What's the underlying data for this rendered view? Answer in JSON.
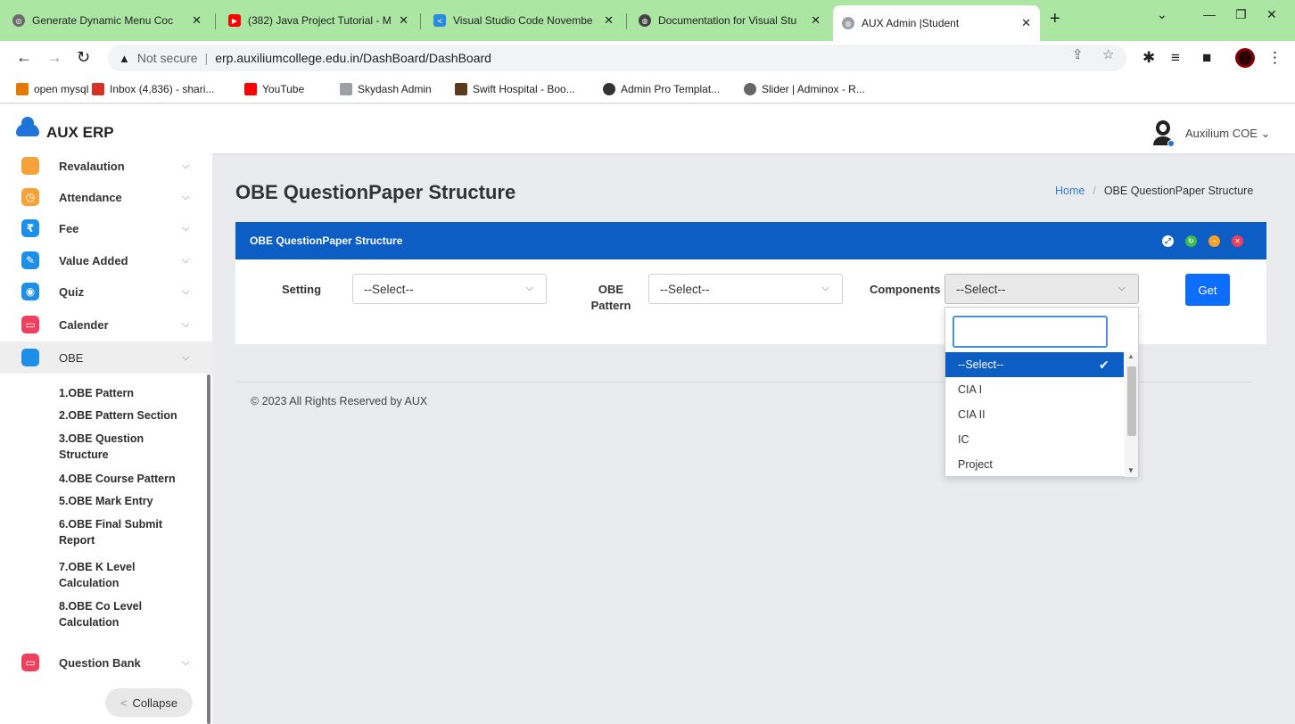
{
  "browser": {
    "tabs": [
      {
        "title": "Generate Dynamic Menu Coc",
        "favicon": "openai-icon",
        "color": "#6b6b6b"
      },
      {
        "title": "(382) Java Project Tutorial - M",
        "favicon": "youtube-icon",
        "color": "#ff0000"
      },
      {
        "title": "Visual Studio Code Novembe",
        "favicon": "vscode-icon",
        "color": "#2b8ae0"
      },
      {
        "title": "Documentation for Visual Stu",
        "favicon": "globe-icon",
        "color": "#444444"
      },
      {
        "title": "AUX Admin |Student",
        "favicon": "globe-icon",
        "color": "#6b6b6b"
      }
    ],
    "new_tab": "+",
    "url_warning": "Not secure",
    "url": "erp.auxiliumcollege.edu.in/DashBoard/DashBoard",
    "bookmarks": [
      {
        "label": "open mysql",
        "color": "#e07b00"
      },
      {
        "label": "Inbox (4,836) - shari...",
        "color": "#d93025"
      },
      {
        "label": "YouTube",
        "color": "#ff0000"
      },
      {
        "label": "Skydash Admin",
        "color": "#9aa0a6"
      },
      {
        "label": "Swift Hospital - Boo...",
        "color": "#5a3a1a"
      },
      {
        "label": "Admin Pro Templat...",
        "color": "#333333"
      },
      {
        "label": "Slider | Adminox - R...",
        "color": "#666666"
      }
    ]
  },
  "app": {
    "logo": "AUX ERP",
    "user": "Auxilium COE",
    "accent": "#0c5dc4"
  },
  "sidebar": {
    "items": [
      {
        "label": "Revalaution",
        "icon": "book-icon",
        "color": "#f6a23a",
        "glyph": ""
      },
      {
        "label": "Attendance",
        "icon": "clock-icon",
        "color": "#f6a23a",
        "glyph": "◷"
      },
      {
        "label": "Fee",
        "icon": "rupee-icon",
        "color": "#1e8fe8",
        "glyph": "₹"
      },
      {
        "label": "Value Added",
        "icon": "edit-icon",
        "color": "#1e8fe8",
        "glyph": "✎"
      },
      {
        "label": "Quiz",
        "icon": "target-icon",
        "color": "#1e8fe8",
        "glyph": "◉"
      },
      {
        "label": "Calender",
        "icon": "calendar-icon",
        "color": "#ee3f5c",
        "glyph": "▭"
      },
      {
        "label": "OBE",
        "icon": "book-icon",
        "color": "#1e8fe8",
        "glyph": ""
      }
    ],
    "obe_sub": [
      "1.OBE Pattern",
      "2.OBE Pattern Section",
      "3.OBE Question Structure",
      "4.OBE Course Pattern",
      "5.OBE Mark Entry",
      "6.OBE Final Submit Report",
      "7.OBE K Level Calculation",
      "8.OBE Co Level Calculation"
    ],
    "question_bank": {
      "label": "Question Bank",
      "icon": "calendar-icon",
      "color": "#ee3f5c"
    },
    "collapse": "Collapse"
  },
  "main": {
    "title": "OBE QuestionPaper Structure",
    "breadcrumb": {
      "home": "Home",
      "current": "OBE QuestionPaper Structure"
    },
    "card_title": "OBE QuestionPaper Structure",
    "fields": {
      "setting_label": "Setting",
      "setting_value": "--Select--",
      "pattern_label": "OBE Pattern",
      "pattern_value": "--Select--",
      "components_label": "Components",
      "components_value": "--Select--"
    },
    "get_button": "Get",
    "footer": "© 2023 All Rights Reserved by AUX"
  },
  "dropdown": {
    "search_value": "",
    "options": [
      "--Select--",
      "CIA I",
      "CIA II",
      "IC",
      "Project"
    ],
    "selected": "--Select--"
  }
}
